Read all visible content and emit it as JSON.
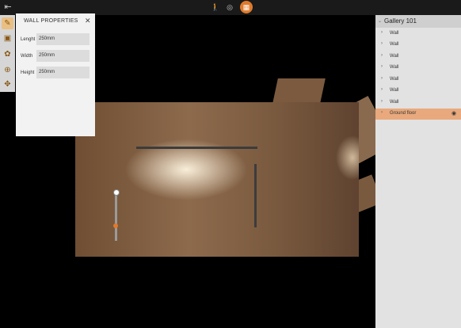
{
  "topbar": {
    "icons": [
      "back-icon",
      "walk-icon",
      "orbit-icon",
      "floorplan-icon"
    ],
    "active_mode": "floorplan"
  },
  "tools": {
    "icons": [
      "draw-wall-icon",
      "image-icon",
      "gallery-icon",
      "zoom-icon",
      "move-icon"
    ],
    "active": "draw-wall"
  },
  "wall_properties": {
    "title": "WALL PROPERTIES",
    "close": "✕",
    "fields": [
      {
        "label": "Lenght",
        "value": "250mm"
      },
      {
        "label": "Width",
        "value": "250mm"
      },
      {
        "label": "Height",
        "value": "250mm"
      }
    ]
  },
  "sidebar": {
    "title": "Gallery 101",
    "items": [
      {
        "label": "Wall"
      },
      {
        "label": "Wall"
      },
      {
        "label": "Wall"
      },
      {
        "label": "Wall"
      },
      {
        "label": "Wall"
      },
      {
        "label": "Wall"
      },
      {
        "label": "Wall"
      },
      {
        "label": "Ground floor",
        "selected": true
      }
    ]
  },
  "colors": {
    "accent": "#e07a2c",
    "selected_row": "#e9a97d",
    "floor": "#8d6a4c"
  }
}
